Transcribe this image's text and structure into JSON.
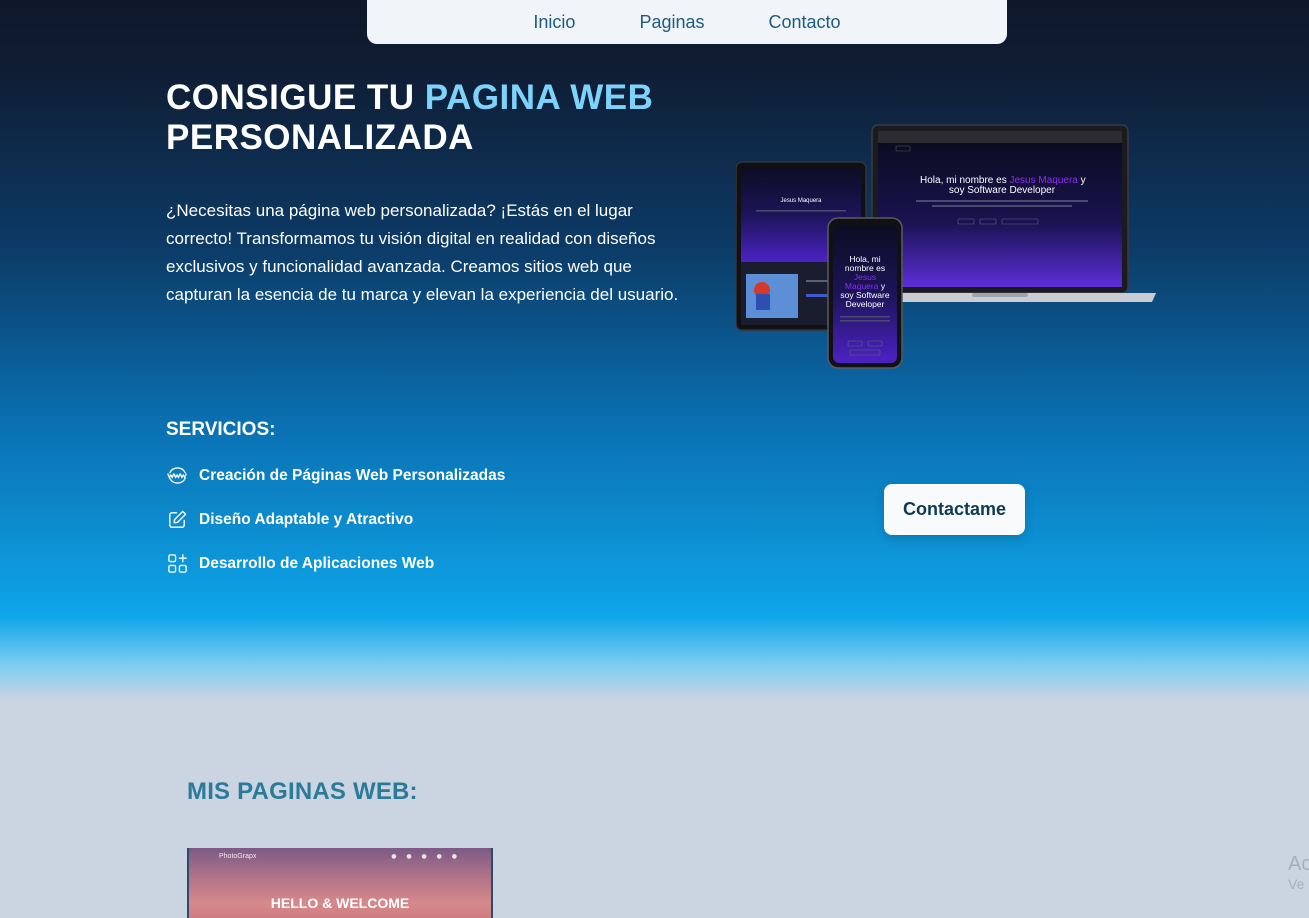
{
  "nav": {
    "items": [
      {
        "label": "Inicio"
      },
      {
        "label": "Paginas"
      },
      {
        "label": "Contacto"
      }
    ]
  },
  "hero": {
    "title_part1": "CONSIGUE TU ",
    "title_accent": "PAGINA WEB",
    "title_part2": "PERSONALIZADA",
    "description": "¿Necesitas una página web personalizada? ¡Estás en el lugar correcto! Transformamos tu visión digital en realidad con diseños exclusivos y funcionalidad avanzada. Creamos sitios web que capturan la esencia de tu marca y elevan la experiencia del usuario."
  },
  "mockup": {
    "greeting_prefix": "Hola, mi nombre es ",
    "name": "Jesus Maquera",
    "greeting_suffix": " y",
    "role": "soy Software Developer"
  },
  "services": {
    "title": "SERVICIOS:",
    "items": [
      {
        "label": "Creación de Páginas Web Personalizadas",
        "icon": "www-icon"
      },
      {
        "label": "Diseño Adaptable y Atractivo",
        "icon": "pencil-square-icon"
      },
      {
        "label": "Desarrollo de Aplicaciones Web",
        "icon": "apps-add-icon"
      }
    ]
  },
  "cta": {
    "label": "Contactame"
  },
  "projects": {
    "title": "MIS PAGINAS WEB:",
    "items": [
      {
        "logo": "PhotoGrapx",
        "heading": "HELLO & WELCOME"
      }
    ]
  },
  "watermark": {
    "line1": "Ac",
    "line2": "Ve"
  },
  "colors": {
    "accent": "#7dd3fc",
    "nav_text": "#1e5a80",
    "section_title": "#2b7a98",
    "page_bg": "#cbd5e1",
    "mockup_name": "#8b2cf5"
  }
}
